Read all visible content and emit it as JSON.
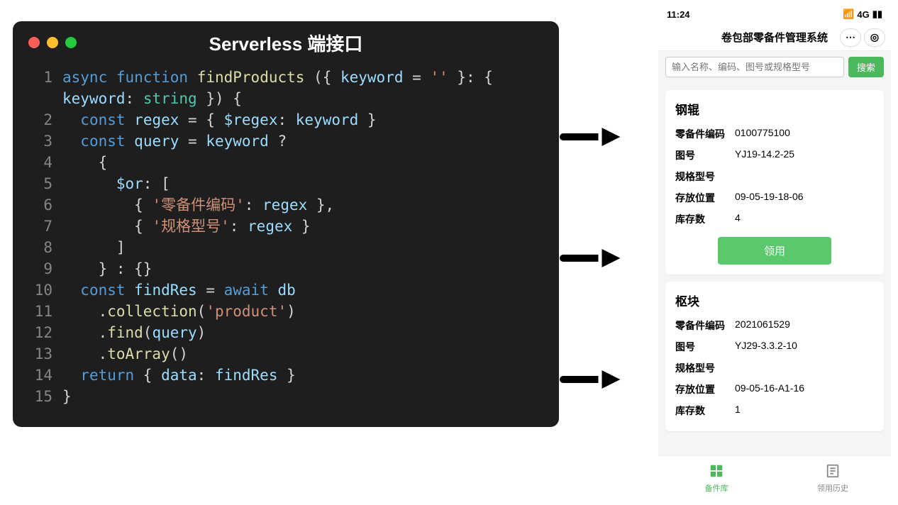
{
  "code": {
    "title": "Serverless 端接口",
    "lines": [
      "<span class='t-kw'>async</span> <span class='t-kw'>function</span> <span class='t-fn'>findProducts</span> ({ <span class='t-id'>keyword</span> = <span class='t-str'>''</span> }: {",
      "<span class='t-id'>keyword</span>: <span class='t-type'>string</span> }) {",
      "  <span class='t-kw'>const</span> <span class='t-id'>regex</span> = { <span class='t-id'>$regex</span>: <span class='t-id'>keyword</span> }",
      "  <span class='t-kw'>const</span> <span class='t-id'>query</span> = <span class='t-id'>keyword</span> ?",
      "    {",
      "      <span class='t-id'>$or</span>: [",
      "        { <span class='t-str'>'零备件编码'</span>: <span class='t-id'>regex</span> },",
      "        { <span class='t-str'>'规格型号'</span>: <span class='t-id'>regex</span> }",
      "      ]",
      "    } : {}",
      "  <span class='t-kw'>const</span> <span class='t-id'>findRes</span> = <span class='t-kw'>await</span> <span class='t-id'>db</span>",
      "    .<span class='t-fn'>collection</span>(<span class='t-str'>'product'</span>)",
      "    .<span class='t-fn'>find</span>(<span class='t-id'>query</span>)",
      "    .<span class='t-fn'>toArray</span>()",
      "  <span class='t-kw'>return</span> { <span class='t-id'>data</span>: <span class='t-id'>findRes</span> }",
      "}"
    ],
    "line_numbers": [
      1,
      1,
      2,
      3,
      4,
      5,
      6,
      7,
      8,
      9,
      10,
      11,
      12,
      13,
      14,
      15
    ]
  },
  "phone": {
    "status": {
      "time": "11:24",
      "network": "4G"
    },
    "header": {
      "title": "卷包部零备件管理系统"
    },
    "search": {
      "placeholder": "输入名称、编码、图号或规格型号",
      "button": "搜索"
    },
    "labels": {
      "code": "零备件编码",
      "drawing": "图号",
      "spec": "规格型号",
      "location": "存放位置",
      "stock": "库存数",
      "claim": "领用"
    },
    "items": [
      {
        "name": "钢辊",
        "code": "0100775100",
        "drawing": "YJ19-14.2-25",
        "spec": "",
        "location": "09-05-19-18-06",
        "stock": "4"
      },
      {
        "name": "枢块",
        "code": "2021061529",
        "drawing": "YJ29-3.3.2-10",
        "spec": "",
        "location": "09-05-16-A1-16",
        "stock": "1"
      }
    ],
    "tabs": [
      {
        "label": "备件库",
        "active": true
      },
      {
        "label": "领用历史",
        "active": false
      }
    ]
  }
}
